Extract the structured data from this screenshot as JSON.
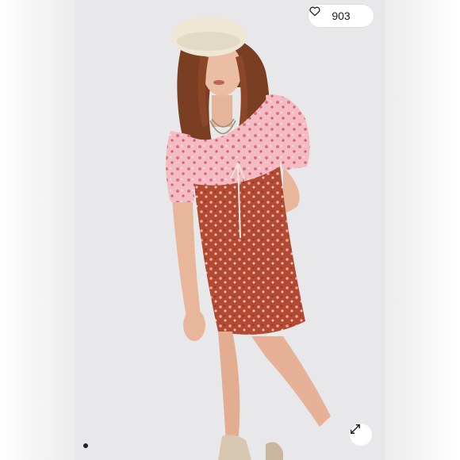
{
  "listing": {
    "like_count": "903",
    "like_icon": "heart-outline-icon",
    "expand_icon": "expand-arrows-icon",
    "carousel": {
      "current": 1,
      "total": 1
    }
  },
  "colors": {
    "photo_background": "#e8e7e9",
    "dress_rust": "#b04a34",
    "dress_pink": "#f2b6bf",
    "button_white": "#ffffff"
  }
}
